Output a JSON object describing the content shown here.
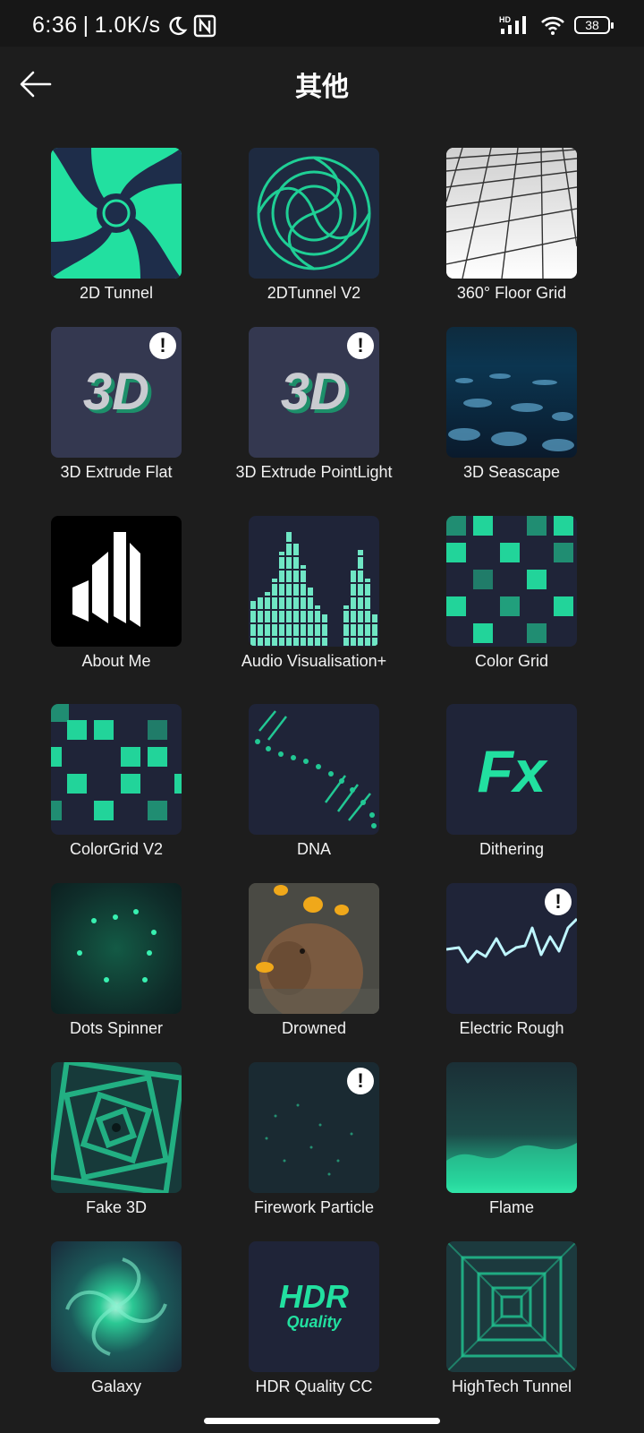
{
  "status_bar": {
    "time": "6:36",
    "net_speed": "1.0K/s",
    "network_badge": "HD",
    "battery": "38",
    "icons": [
      "moon-icon",
      "nfc-icon",
      "signal-icon",
      "wifi-icon",
      "battery-icon"
    ]
  },
  "header": {
    "title": "其他",
    "back_icon": "arrow-left-icon"
  },
  "colors": {
    "background": "#1d1d1d",
    "accent": "#22e0a0",
    "tile_bg": "#262a40"
  },
  "items": [
    {
      "label": "2D Tunnel"
    },
    {
      "label": "2DTunnel V2"
    },
    {
      "label": "360° Floor Grid"
    },
    {
      "label": "3D Extrude Flat",
      "warning": "!",
      "thumb_text": "3D"
    },
    {
      "label": "3D Extrude PointLight",
      "warning": "!",
      "thumb_text": "3D"
    },
    {
      "label": "3D Seascape"
    },
    {
      "label": "About Me"
    },
    {
      "label": "Audio Visualisation+"
    },
    {
      "label": "Color Grid"
    },
    {
      "label": "ColorGrid V2"
    },
    {
      "label": "DNA"
    },
    {
      "label": "Dithering",
      "thumb_text": "Fx"
    },
    {
      "label": "Dots Spinner"
    },
    {
      "label": "Drowned"
    },
    {
      "label": "Electric Rough",
      "warning": "!"
    },
    {
      "label": "Fake 3D"
    },
    {
      "label": "Firework Particle",
      "warning": "!"
    },
    {
      "label": "Flame"
    },
    {
      "label": "Galaxy"
    },
    {
      "label": "HDR Quality CC",
      "thumb_text": "HDR",
      "thumb_subtext": "Quality"
    },
    {
      "label": "HighTech Tunnel"
    }
  ]
}
